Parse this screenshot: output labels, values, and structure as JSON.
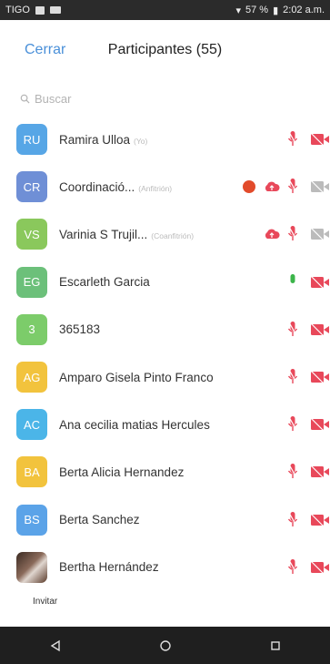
{
  "status_bar": {
    "carrier": "TIGO",
    "battery": "57 %",
    "time": "2:02 a.m."
  },
  "header": {
    "close_label": "Cerrar",
    "title": "Participantes (55)"
  },
  "search": {
    "placeholder": "Buscar"
  },
  "participants": [
    {
      "initials": "RU",
      "name": "Ramira Ulloa",
      "tag": "(Yo)",
      "color": "#57a6e6",
      "mic": "muted",
      "video": "off"
    },
    {
      "initials": "CR",
      "name": "Coordinació...",
      "tag": "(Anfitrión)",
      "color": "#6f8fd6",
      "mic": "muted",
      "video": "off-gray",
      "extra": [
        "raise-hand-badge",
        "cloud-record-icon"
      ]
    },
    {
      "initials": "VS",
      "name": "Varinia S Trujil...",
      "tag": "(Coanfitrión)",
      "color": "#8ac85c",
      "mic": "muted",
      "video": "off-gray",
      "extra": [
        "cloud-record-icon"
      ]
    },
    {
      "initials": "EG",
      "name": "Escarleth Garcia",
      "tag": "",
      "color": "#6cc07a",
      "mic": "on",
      "video": "off"
    },
    {
      "initials": "3",
      "name": "365183",
      "tag": "",
      "color": "#7ccc6a",
      "mic": "muted",
      "video": "off"
    },
    {
      "initials": "AG",
      "name": "Amparo Gisela Pinto Franco",
      "tag": "",
      "color": "#f2c33d",
      "mic": "muted",
      "video": "off"
    },
    {
      "initials": "AC",
      "name": "Ana cecilia matias Hercules",
      "tag": "",
      "color": "#4bb5e8",
      "mic": "muted",
      "video": "off"
    },
    {
      "initials": "BA",
      "name": "Berta Alicia Hernandez",
      "tag": "",
      "color": "#f2c33d",
      "mic": "muted",
      "video": "off"
    },
    {
      "initials": "BS",
      "name": "Berta Sanchez",
      "tag": "",
      "color": "#5ba3e8",
      "mic": "muted",
      "video": "off"
    },
    {
      "initials": "",
      "name": "Bertha Hernández",
      "tag": "",
      "color": "#6b4a3a",
      "mic": "muted",
      "video": "off",
      "photo": true
    }
  ],
  "footer": {
    "invite_label": "Invitar"
  },
  "nav": {
    "back_glyph": "◁",
    "home_glyph": "○",
    "recent_glyph": "□"
  },
  "colors": {
    "accent": "#4a90d9",
    "muted_red": "#e8485a",
    "mic_on_green": "#3cb54a",
    "cloud_red": "#e8485a"
  }
}
